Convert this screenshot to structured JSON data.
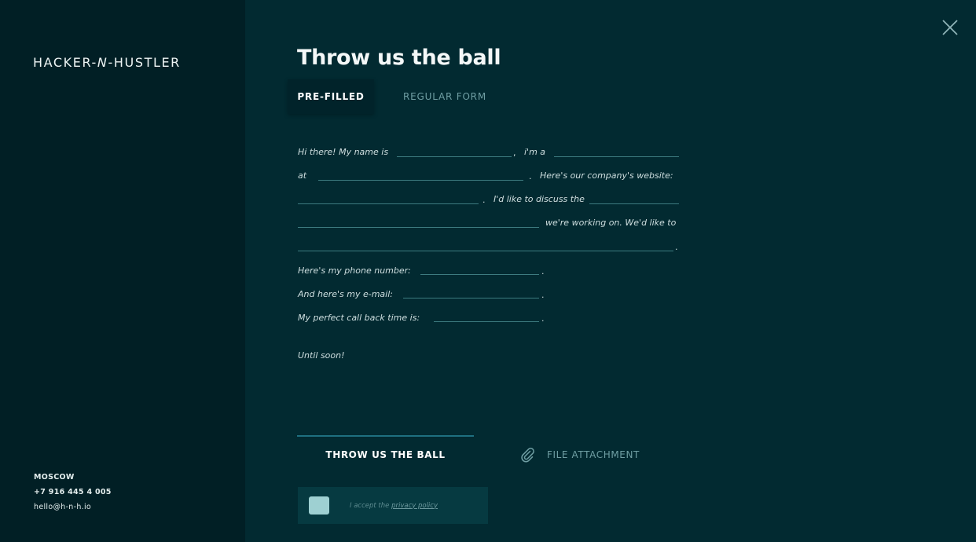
{
  "sidebar": {
    "logo": "HACKER-N-HUSTLER",
    "city": "MOSCOW",
    "phone": "+7 916 445 4 005",
    "email": "hello@h-n-h.io"
  },
  "header": {
    "title": "Throw us the ball",
    "close_icon": "close-icon"
  },
  "tabs": [
    {
      "label": "PRE-FILLED",
      "active": true
    },
    {
      "label": "REGULAR FORM",
      "active": false
    }
  ],
  "form": {
    "intro": "Hi there! My name is",
    "comma": ",",
    "im_a": "i'm a",
    "at": "at",
    "website": "Here's our company's website:",
    "discuss": "I'd like to discuss the",
    "working_on": "we're working on. We'd like to",
    "phone_label": "Here's my phone number:",
    "email_label": "And here's my e-mail:",
    "callback_label": "My perfect call back time is:",
    "period": ".",
    "closing": "Until soon!",
    "fields": {
      "name": "",
      "role": "",
      "company": "",
      "website": "",
      "topic": "",
      "project": "",
      "goal": "",
      "phone": "",
      "email": "",
      "callback": ""
    }
  },
  "actions": {
    "submit_label": "THROW US THE BALL",
    "attach_label": "FILE ATTACHMENT",
    "attach_icon": "paperclip-icon"
  },
  "consent": {
    "text": "I accept the",
    "link": "privacy policy",
    "checked": false
  },
  "colors": {
    "background": "#022a31",
    "sidebar": "#011f25",
    "accent": "#1e6f80",
    "checkbox": "#9ed0d2"
  }
}
